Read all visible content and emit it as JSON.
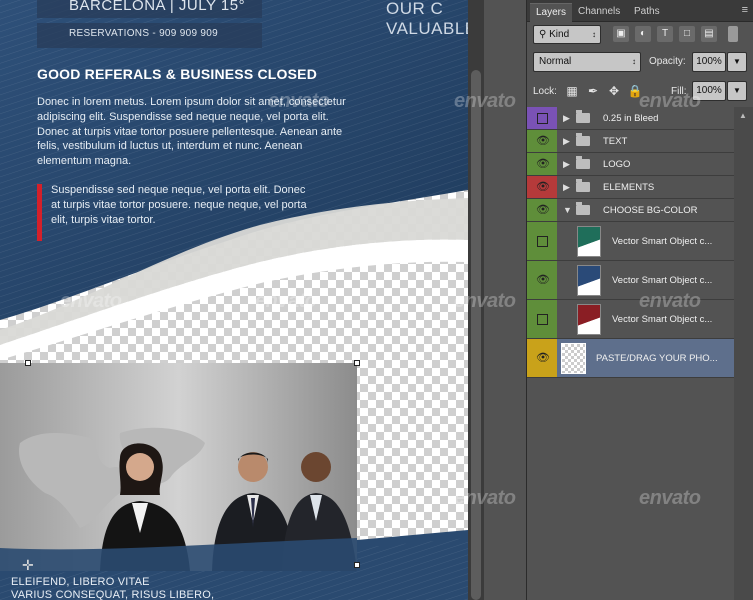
{
  "canvas": {
    "header_event": "BARCELONA | JULY 15°",
    "header_reservations": "RESERVATIONS - 909 909 909",
    "header_right_line1": "OUR C",
    "header_right_line2": "VALUABLE",
    "headline": "GOOD REFERALS & BUSINESS CLOSED",
    "body_text": "Donec in lorem metus. Lorem ipsum dolor sit amet, consectetur adipiscing elit. Suspendisse sed neque neque, vel porta elit. Donec at turpis vitae tortor posuere pellentesque. Aenean ante felis, vestibulum id luctus ut, interdum et nunc. Aenean elementum magna.",
    "quote_text": "Suspendisse sed neque neque, vel porta elit. Donec at turpis vitae tortor posuere. neque neque, vel porta elit, turpis vitae tortor.",
    "footer_line1": "ELEIFEND, LIBERO VITAE",
    "footer_line2": "VARIUS CONSEQUAT, RISUS LIBERO,",
    "watermark": "envato",
    "colors": {
      "flyer_blue": "#2d4a6e",
      "accent_red": "#d4202a",
      "crosshair": "✛"
    }
  },
  "panel": {
    "tabs": {
      "layers": "Layers",
      "channels": "Channels",
      "paths": "Paths"
    },
    "menu_icon": "≡",
    "filter": {
      "label": "Kind",
      "icon": "search-icon"
    },
    "filter_buttons": [
      "image-filter-icon",
      "adjustment-filter-icon",
      "type-filter-icon",
      "shape-filter-icon",
      "smart-object-filter-icon",
      "toggle-filter-icon"
    ],
    "blend_mode": "Normal",
    "opacity_label": "Opacity:",
    "opacity_value": "100%",
    "lock_label": "Lock:",
    "fill_label": "Fill:",
    "fill_value": "100%",
    "layers": [
      {
        "name": "0.25 in Bleed",
        "type": "group",
        "visible": false,
        "tag_color": "#7a52b5"
      },
      {
        "name": "TEXT",
        "type": "group",
        "visible": true,
        "tag_color": "#5f8e3a"
      },
      {
        "name": "LOGO",
        "type": "group",
        "visible": true,
        "tag_color": "#5f8e3a"
      },
      {
        "name": "ELEMENTS",
        "type": "group",
        "visible": true,
        "tag_color": "#b53a3a"
      },
      {
        "name": "CHOOSE BG-COLOR",
        "type": "group-open",
        "visible": true,
        "tag_color": "#5f8e3a"
      },
      {
        "name": "Vector Smart Object c...",
        "type": "smart-object",
        "visible": false,
        "tag_color": "#5f8e3a",
        "thumb_color": "#1f6e5a"
      },
      {
        "name": "Vector Smart Object c...",
        "type": "smart-object",
        "visible": true,
        "tag_color": "#5f8e3a",
        "thumb_color": "#2a4a78"
      },
      {
        "name": "Vector Smart Object c...",
        "type": "smart-object",
        "visible": false,
        "tag_color": "#5f8e3a",
        "thumb_color": "#8a1e24"
      },
      {
        "name": "PASTE/DRAG YOUR PHO...",
        "type": "photo",
        "visible": true,
        "tag_color": "#c9a21a",
        "selected": true
      }
    ]
  }
}
